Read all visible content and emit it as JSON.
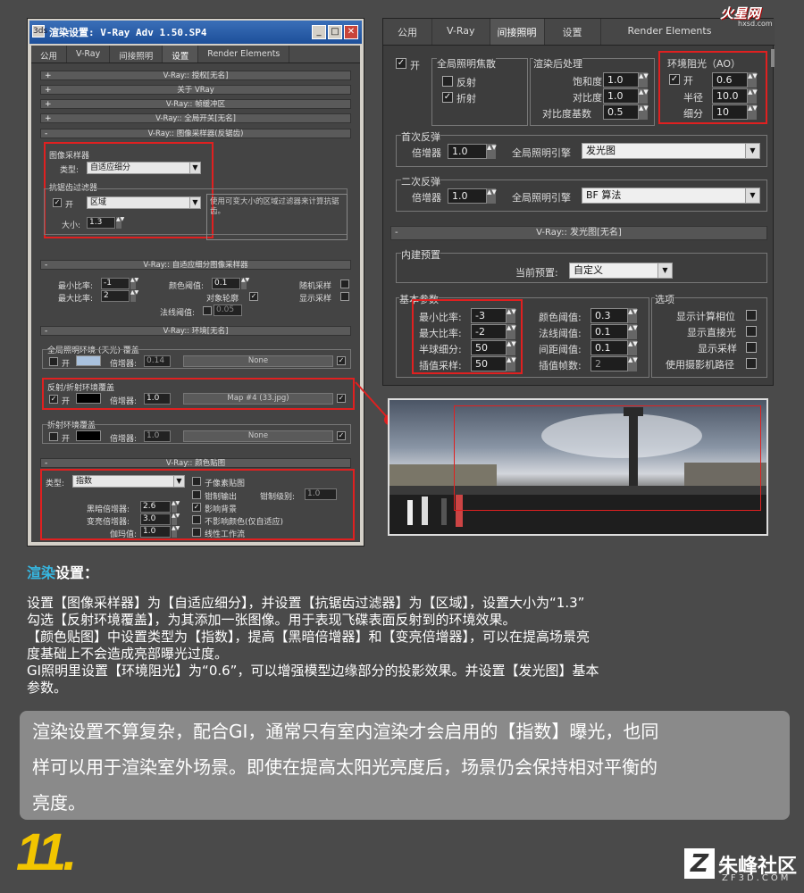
{
  "win": {
    "title": "渲染设置: V-Ray Adv 1.50.SP4",
    "min": "_",
    "max": "□",
    "close": "✕",
    "icon_text": "3ds"
  },
  "tabs": [
    "公用",
    "V-Ray",
    "间接照明",
    "设置",
    "Render Elements"
  ],
  "rolls": [
    "V-Ray:: 授权[无名]",
    "关于 VRay",
    "V-Ray:: 帧缓冲区",
    "V-Ray:: 全局开关[无名]",
    "V-Ray:: 图像采样器(反锯齿)"
  ],
  "sampler": {
    "group": "图像采样器",
    "type_label": "类型:",
    "type_value": "自适应细分",
    "aa_group": "抗锯齿过滤器",
    "on": "开",
    "filter": "区域",
    "desc": "使用可变大小的区域过滤器来计算抗锯齿。",
    "size_label": "大小:",
    "size": "1.3"
  },
  "adapt": {
    "title": "V-Ray:: 自适应细分图像采样器",
    "min_rate": "最小比率:",
    "min_v": "-1",
    "max_rate": "最大比率:",
    "max_v": "2",
    "clr": "颜色阈值:",
    "clr_v": "0.1",
    "obj": "对象轮廓",
    "nrm": "法线阈值:",
    "nrm_v": "0.05",
    "rand": "随机采样",
    "show": "显示采样"
  },
  "env": {
    "title": "V-Ray:: 环境[无名]",
    "gi": "全局照明环境 (天光) 覆盖",
    "on": "开",
    "mult": "倍增器:",
    "gi_mult": "0.14",
    "none": "None",
    "refl": "反射/折射环境覆盖",
    "refl_mult": "1.0",
    "map": "Map #4 (33.jpg)",
    "refr": "折射环境覆盖",
    "refr_mult": "1.0"
  },
  "cm": {
    "title": "V-Ray:: 颜色贴图",
    "type_label": "类型:",
    "type": "指数",
    "dark": "黑暗倍增器:",
    "dark_v": "2.6",
    "bright": "变亮倍增器:",
    "bright_v": "3.0",
    "gamma": "伽玛值:",
    "gamma_v": "1.0",
    "sub": "子像素贴图",
    "clamp": "钳制输出",
    "clamp_lvl": "钳制级别:",
    "clamp_v": "1.0",
    "affect": "影响背景",
    "noaffect": "不影响颜色(仅自适应)",
    "linear": "线性工作流"
  },
  "r": {
    "tabs": [
      "公用",
      "V-Ray",
      "间接照明",
      "设置",
      "Render Elements"
    ],
    "on": "开",
    "gic": "全局照明焦散",
    "refl": "反射",
    "refr": "折射",
    "post": "渲染后处理",
    "sat": "饱和度",
    "sat_v": "1.0",
    "con": "对比度",
    "con_v": "1.0",
    "conb": "对比度基数",
    "conb_v": "0.5",
    "ao": "环境阻光（AO）",
    "ao_on": "开",
    "ao_v": "0.6",
    "rad": "半径",
    "rad_v": "10.0",
    "sub": "细分",
    "sub_v": "10",
    "pb": "首次反弹",
    "mult": "倍增器",
    "pb_v": "1.0",
    "eng": "全局照明引擎",
    "pb_eng": "发光图",
    "sb": "二次反弹",
    "sb_v": "1.0",
    "sb_eng": "BF 算法",
    "im": "V-Ray:: 发光图[无名]",
    "preset_grp": "内建预置",
    "preset": "当前预置:",
    "preset_v": "自定义",
    "basic": "基本参数",
    "minr": "最小比率:",
    "minr_v": "-3",
    "maxr": "最大比率:",
    "maxr_v": "-2",
    "hsph": "半球细分:",
    "hsph_v": "50",
    "interp": "插值采样:",
    "interp_v": "50",
    "clr": "颜色阈值:",
    "clr_v": "0.3",
    "nrm": "法线阈值:",
    "nrm_v": "0.1",
    "dist": "间距阈值:",
    "dist_v": "0.1",
    "ifr": "插值帧数:",
    "ifr_v": "2",
    "opt": "选项",
    "o1": "显示计算相位",
    "o2": "显示直接光",
    "o3": "显示采样",
    "o4": "使用摄影机路径"
  },
  "text": {
    "h1": "渲染",
    "h2": "设置：",
    "p1": "设置【图像采样器】为【自适应细分】，并设置【抗锯齿过滤器】为【区域】，设置大小为“1.3”",
    "p2": "勾选【反射环境覆盖】，为其添加一张图像。用于表现飞碟表面反射到的环境效果。",
    "p3": "【颜色贴图】中设置类型为【指数】，提高【黑暗倍增器】和【变亮倍增器】，可以在提高场景亮",
    "p4": "度基础上不会造成亮部曝光过度。",
    "p5": "GI照明里设置【环境阻光】为“0.6”，可以增强模型边缘部分的投影效果。并设置【发光图】基本",
    "p6": "参数。",
    "box1": "渲染设置不算复杂，配合GI，通常只有室内渲染才会启用的【指数】曝光，也同",
    "box2": "样可以用于渲染室外场景。即使在提高太阳光亮度后，场景仍会保持相对平衡的",
    "box3": "亮度。",
    "step": "11.",
    "logo_top": "火星网",
    "logo_url": "hxsd.com",
    "brand": "朱峰社区",
    "brand_url": "ZF3D.COM"
  },
  "colors": {
    "accent": "#e02020",
    "cyan": "#36b6e0",
    "yellow": "#f2c500"
  }
}
